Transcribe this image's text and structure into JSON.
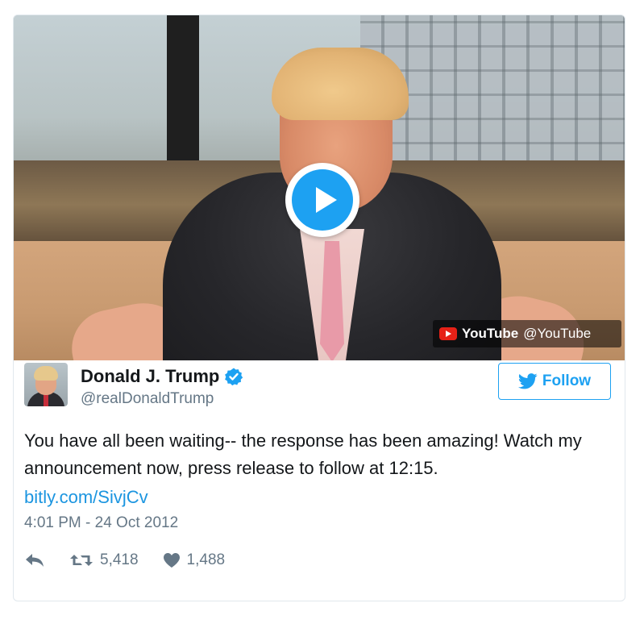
{
  "media": {
    "provider_name": "YouTube",
    "provider_handle": "@YouTube",
    "play_icon": "play-icon"
  },
  "tweet": {
    "author_name": "Donald J. Trump",
    "author_handle": "@realDonaldTrump",
    "verified": true,
    "follow_label": "Follow",
    "text": "You have all been waiting-- the response has been amazing! Watch my announcement now, press release to follow at 12:15.",
    "link": "bitly.com/SivjCv",
    "timestamp": "4:01 PM - 24 Oct 2012",
    "retweets": "5,418",
    "likes": "1,488"
  },
  "colors": {
    "accent": "#1da1f2",
    "link": "#1b95e0",
    "secondary_text": "#657786",
    "border": "#e1e8ed",
    "youtube_red": "#e62117"
  },
  "icons": [
    "play-icon",
    "youtube-logo-icon",
    "verified-badge-icon",
    "twitter-bird-icon",
    "reply-icon",
    "retweet-icon",
    "heart-icon"
  ]
}
